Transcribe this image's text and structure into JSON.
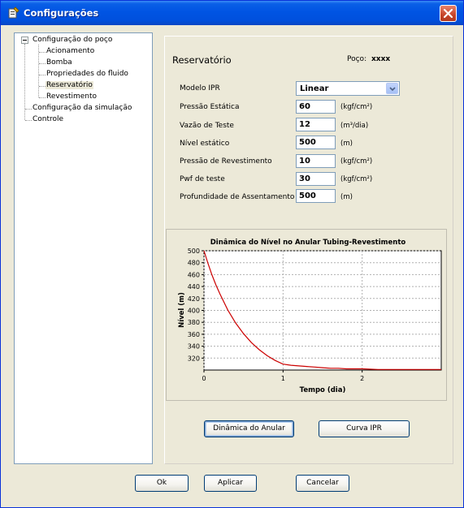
{
  "window": {
    "title": "Configurações",
    "title_icon": "tools-icon",
    "close_icon": "close-icon"
  },
  "tree": {
    "items": [
      {
        "label": "Configuração do poço",
        "level": 0,
        "expanded": true,
        "selected": false
      },
      {
        "label": "Acionamento",
        "level": 1,
        "selected": false
      },
      {
        "label": "Bomba",
        "level": 1,
        "selected": false
      },
      {
        "label": "Propriedades do fluido",
        "level": 1,
        "selected": false
      },
      {
        "label": "Reservatório",
        "level": 1,
        "selected": true
      },
      {
        "label": "Revestimento",
        "level": 1,
        "selected": false
      },
      {
        "label": "Configuração da simulação",
        "level": 0,
        "selected": false
      },
      {
        "label": "Controle",
        "level": 0,
        "selected": false
      }
    ]
  },
  "panel": {
    "title": "Reservatório",
    "poco_label": "Poço:",
    "poco_value": "xxxx",
    "model": {
      "label": "Modelo IPR",
      "value": "Linear"
    },
    "fields": [
      {
        "label": "Pressão Estática",
        "value": "60",
        "unit": "(kgf/cm²)"
      },
      {
        "label": "Vazão de Teste",
        "value": "12",
        "unit": "(m³/dia)"
      },
      {
        "label": "Nível estático",
        "value": "500",
        "unit": "(m)"
      },
      {
        "label": "Pressão de Revestimento",
        "value": "10",
        "unit": "(kgf/cm²)"
      },
      {
        "label": "Pwf de teste",
        "value": "30",
        "unit": "(kgf/cm²)"
      },
      {
        "label": "Profundidade de Assentamento",
        "value": "500",
        "unit": "(m)"
      }
    ],
    "buttons": {
      "dynamics": "Dinâmica do Anular",
      "ipr": "Curva IPR"
    }
  },
  "footer": {
    "ok": "Ok",
    "apply": "Aplicar",
    "cancel": "Cancelar"
  },
  "chart_data": {
    "type": "line",
    "title": "Dinâmica do Nível no Anular Tubing-Revestimento",
    "xlabel": "Tempo (dia)",
    "ylabel": "Nível (m)",
    "xlim": [
      0,
      3
    ],
    "ylim": [
      300,
      500
    ],
    "xticks": [
      0,
      1,
      2
    ],
    "yticks": [
      320,
      340,
      360,
      380,
      400,
      420,
      440,
      460,
      480,
      500
    ],
    "grid": true,
    "line_color": "#cc0000",
    "series": [
      {
        "x": [
          0,
          0.05,
          0.1,
          0.15,
          0.2,
          0.3,
          0.4,
          0.5,
          0.6,
          0.7,
          0.8,
          0.9,
          1.0,
          1.1,
          1.2,
          1.3,
          1.4,
          1.5,
          1.6,
          1.7,
          1.8,
          1.9,
          2.0,
          2.2,
          2.4,
          2.6,
          2.8,
          3.0
        ],
        "y": [
          500,
          479,
          460,
          443,
          428,
          401,
          379,
          361,
          346,
          334,
          324,
          316,
          310,
          308,
          307,
          306,
          305,
          304,
          303,
          303,
          302,
          302,
          302,
          301,
          301,
          301,
          301,
          301
        ]
      }
    ]
  }
}
